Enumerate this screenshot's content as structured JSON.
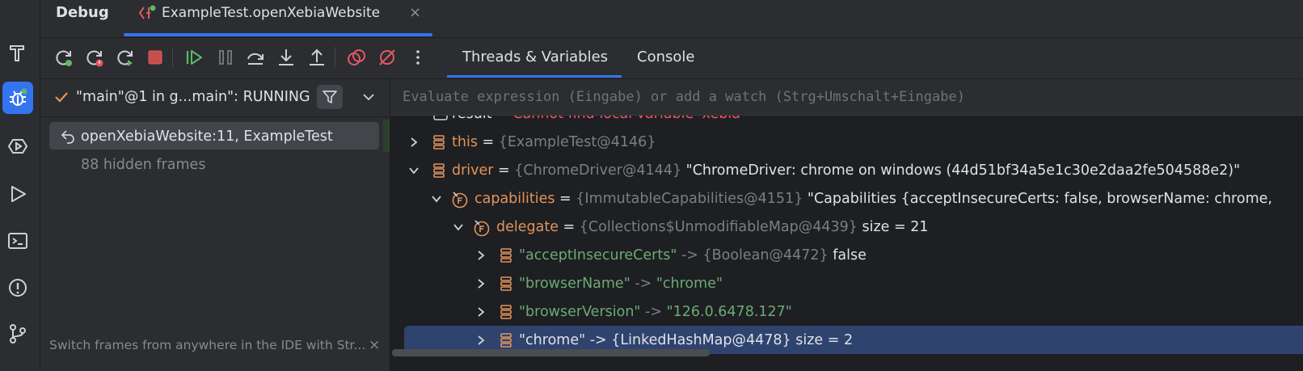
{
  "tool_window": {
    "title": "Debug"
  },
  "session_tab": {
    "label": "ExampleTest.openXebiaWebsite",
    "close": "×"
  },
  "toolbar_tabs": {
    "threads_variables": "Threads & Variables",
    "console": "Console"
  },
  "thread": {
    "label": "\"main\"@1 in g...main\": RUNNING"
  },
  "frames": {
    "selected": "openXebiaWebsite:11, ExampleTest",
    "hidden": "88 hidden frames",
    "hint": "Switch frames from anywhere in the IDE with Str...",
    "hint_close": "×"
  },
  "evaluate": {
    "placeholder": "Evaluate expression (Eingabe) or add a watch (Strg+Umschalt+Eingabe)"
  },
  "variables": {
    "partial_row": {
      "name": "result",
      "sep": " = ",
      "value": "Cannot find local variable 'xebia'"
    },
    "this_row": {
      "name": "this",
      "sep": " = ",
      "ref": "{ExampleTest@4146}"
    },
    "driver_row": {
      "name": "driver",
      "sep": " = ",
      "ref": "{ChromeDriver@4144}",
      "value": " \"ChromeDriver: chrome on windows (44d51bf34a5e1c30e2daa2fe504588e2)\""
    },
    "capabilities_row": {
      "name": "capabilities",
      "sep": " = ",
      "ref": "{ImmutableCapabilities@4151}",
      "value": " \"Capabilities {acceptInsecureCerts: false, browserName: chrome,"
    },
    "delegate_row": {
      "name": "delegate",
      "sep": " = ",
      "ref": "{Collections$UnmodifiableMap@4439}",
      "value": "  size = 21"
    },
    "entries": [
      {
        "key": "\"acceptInsecureCerts\"",
        "arrow": " -> ",
        "ref": "{Boolean@4472}",
        "value": " false"
      },
      {
        "key": "\"browserName\"",
        "arrow": " -> ",
        "value": "\"chrome\""
      },
      {
        "key": "\"browserVersion\"",
        "arrow": " -> ",
        "value": "\"126.0.6478.127\""
      },
      {
        "key": "\"chrome\"",
        "arrow": " -> ",
        "ref": "{LinkedHashMap@4478}",
        "value": "  size = 2"
      }
    ]
  },
  "colors": {
    "accent": "#3574f0",
    "field_name": "#e0945c",
    "string": "#6aab73",
    "selection": "#2e436e",
    "running_check": "#e0945c",
    "error": "#f75464"
  },
  "icons": {
    "strip": [
      "build-icon",
      "debug-icon",
      "services-icon",
      "run-icon",
      "terminal-icon",
      "problems-icon",
      "git-icon"
    ],
    "toolbar": [
      "rerun-icon",
      "rerun-failed-icon",
      "restart-icon",
      "stop-icon",
      "resume-icon",
      "pause-icon",
      "step-over-icon",
      "step-into-icon",
      "step-out-icon",
      "view-breakpoints-icon",
      "mute-breakpoints-icon",
      "more-icon"
    ]
  }
}
